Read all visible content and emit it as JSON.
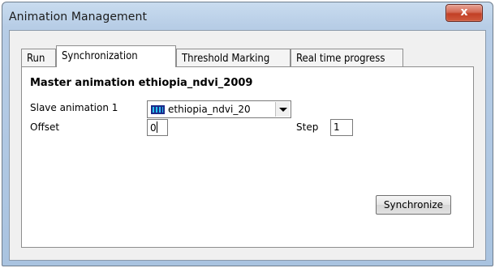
{
  "window": {
    "title": "Animation Management",
    "close_glyph": "x"
  },
  "tabs": [
    {
      "label": "Run",
      "active": false
    },
    {
      "label": "Synchronization",
      "active": true
    },
    {
      "label": "Threshold Marking",
      "active": false
    },
    {
      "label": "Real time progress",
      "active": false
    }
  ],
  "sync": {
    "heading": "Master animation ethiopia_ndvi_2009",
    "slave_label": "Slave animation 1",
    "slave_value": "ethiopia_ndvi_20",
    "slave_icon": "film-icon",
    "offset_label": "Offset",
    "offset_value": "0",
    "step_label": "Step",
    "step_value": "1",
    "synchronize_label": "Synchronize"
  }
}
